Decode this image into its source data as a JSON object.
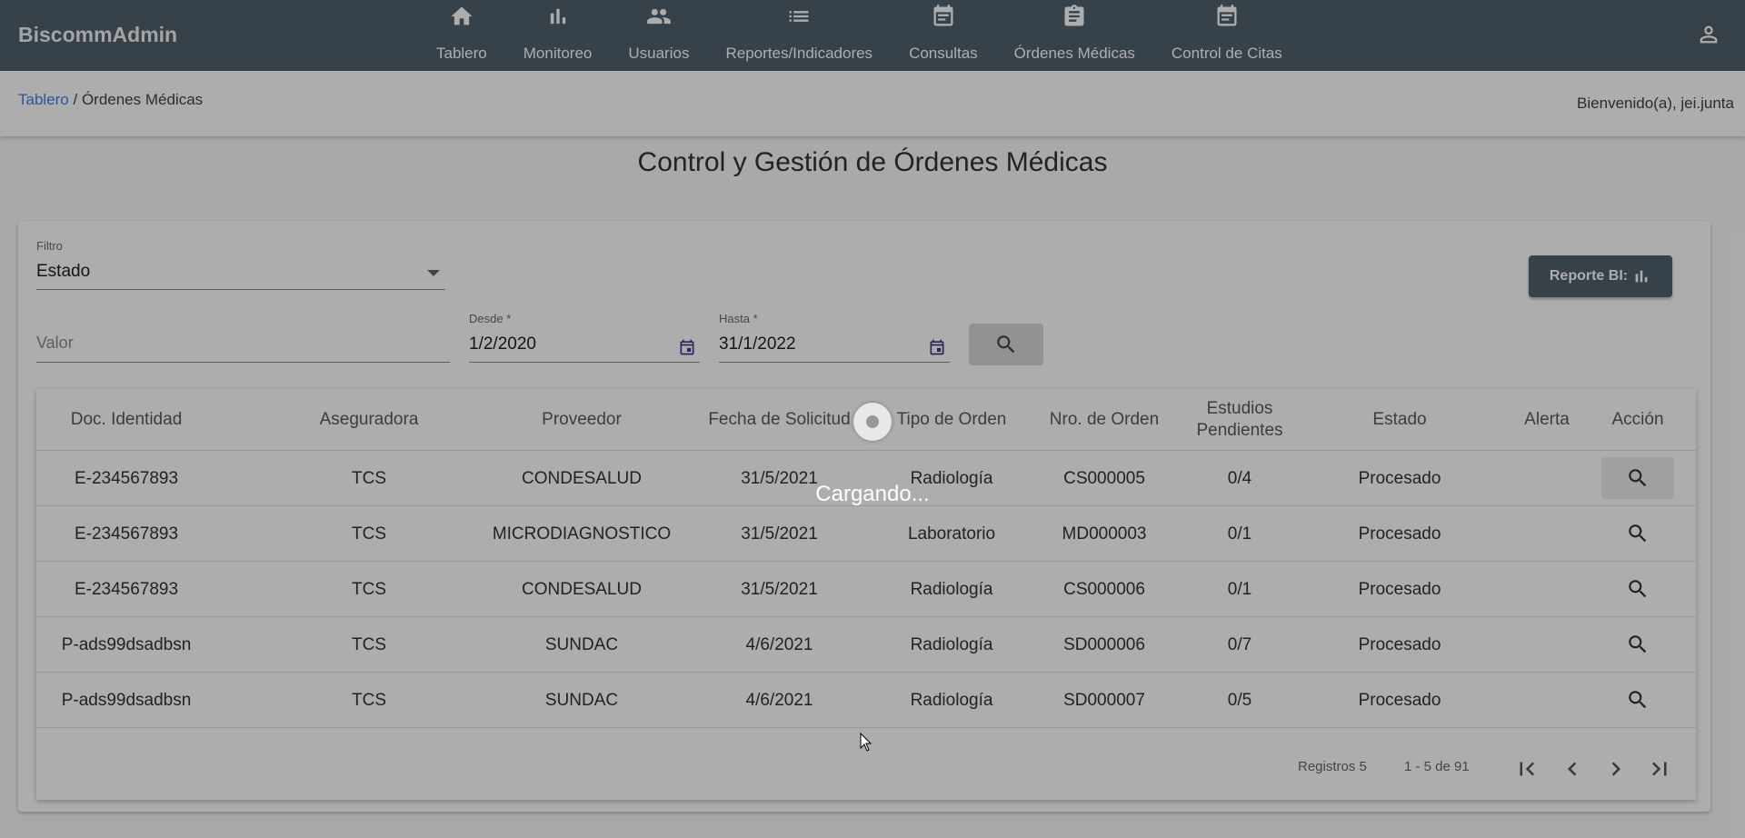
{
  "app": {
    "brand": "BiscommAdmin"
  },
  "nav": [
    {
      "label": "Tablero",
      "icon": "home-icon"
    },
    {
      "label": "Monitoreo",
      "icon": "bar-chart-icon"
    },
    {
      "label": "Usuarios",
      "icon": "people-icon"
    },
    {
      "label": "Reportes/Indicadores",
      "icon": "list-icon"
    },
    {
      "label": "Consultas",
      "icon": "event-note-icon"
    },
    {
      "label": "Órdenes Médicas",
      "icon": "assignment-icon"
    },
    {
      "label": "Control de Citas",
      "icon": "event-note-icon"
    }
  ],
  "breadcrumb": {
    "root": "Tablero",
    "separator": " / ",
    "current": "Órdenes Médicas"
  },
  "welcome": "Bienvenido(a), jei.junta",
  "page": {
    "title": "Control y Gestión de Órdenes Médicas"
  },
  "filters": {
    "filter_label": "Filtro",
    "filter_value": "Estado",
    "value_placeholder": "Valor",
    "from_label": "Desde *",
    "from_value": "1/2/2020",
    "to_label": "Hasta *",
    "to_value": "31/1/2022"
  },
  "bi_button": {
    "label": "Reporte BI:"
  },
  "table": {
    "headers": [
      "Doc. Identidad",
      "Aseguradora",
      "Proveedor",
      "Fecha de Solicitud",
      "Tipo de Orden",
      "Nro. de Orden",
      "Estudios Pendientes",
      "Estado",
      "Alerta",
      "Acción"
    ],
    "rows": [
      [
        "E-234567893",
        "TCS",
        "CONDESALUD",
        "31/5/2021",
        "Radiología",
        "CS000005",
        "0/4",
        "Procesado",
        ""
      ],
      [
        "E-234567893",
        "TCS",
        "MICRODIAGNOSTICO",
        "31/5/2021",
        "Laboratorio",
        "MD000003",
        "0/1",
        "Procesado",
        ""
      ],
      [
        "E-234567893",
        "TCS",
        "CONDESALUD",
        "31/5/2021",
        "Radiología",
        "CS000006",
        "0/1",
        "Procesado",
        ""
      ],
      [
        "P-ads99dsadbsn",
        "TCS",
        "SUNDAC",
        "4/6/2021",
        "Radiología",
        "SD000006",
        "0/7",
        "Procesado",
        ""
      ],
      [
        "P-ads99dsadbsn",
        "TCS",
        "SUNDAC",
        "4/6/2021",
        "Radiología",
        "SD000007",
        "0/5",
        "Procesado",
        ""
      ]
    ]
  },
  "pagination": {
    "page_size": "Registros 5",
    "range": "1 - 5 de 91"
  },
  "loading": {
    "text": "Cargando..."
  },
  "colors": {
    "topbar": "#52606d",
    "link": "#3f7fe0",
    "calendar_icon": "#3d3a8a"
  }
}
